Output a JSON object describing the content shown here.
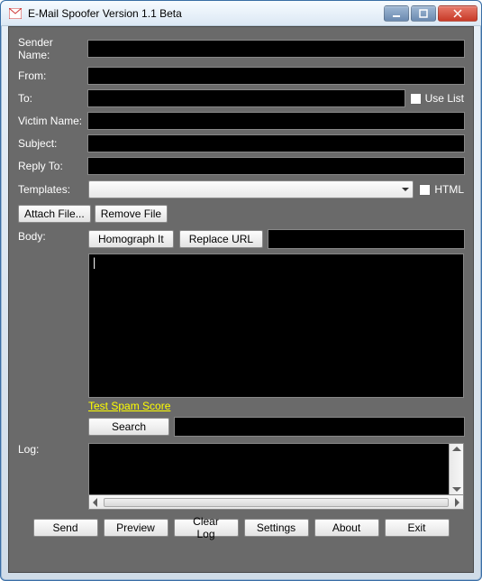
{
  "window": {
    "title": "E-Mail Spoofer Version 1.1 Beta"
  },
  "labels": {
    "sender_name": "Sender Name:",
    "from": "From:",
    "to": "To:",
    "victim_name": "Victim Name:",
    "subject": "Subject:",
    "reply_to": "Reply To:",
    "templates": "Templates:",
    "body": "Body:",
    "log": "Log:"
  },
  "checkboxes": {
    "use_list": "Use List",
    "html": "HTML"
  },
  "buttons": {
    "attach_file": "Attach File...",
    "remove_file": "Remove File",
    "homograph_it": "Homograph It",
    "replace_url": "Replace URL",
    "search": "Search",
    "send": "Send",
    "preview": "Preview",
    "clear_log": "Clear Log",
    "settings": "Settings",
    "about": "About",
    "exit": "Exit"
  },
  "links": {
    "test_spam": "Test Spam Score"
  },
  "fields": {
    "sender_name": "",
    "from": "",
    "to": "",
    "victim_name": "",
    "subject": "",
    "reply_to": "",
    "templates_selected": "",
    "replace_url_value": "",
    "body_text": "",
    "search_value": "",
    "log_text": ""
  }
}
